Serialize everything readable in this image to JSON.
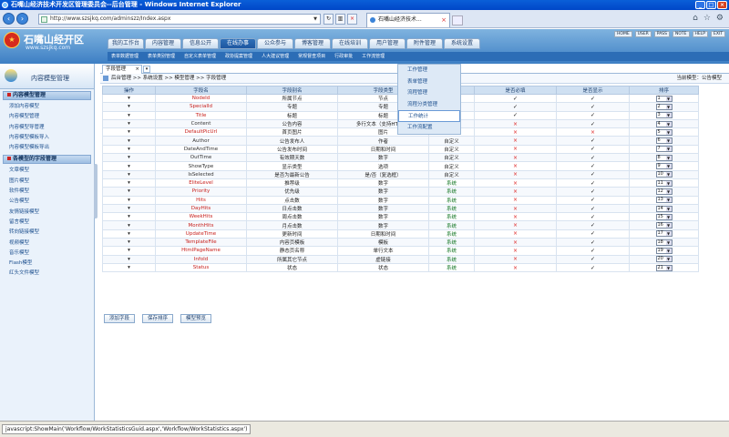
{
  "window": {
    "title": "石嘴山经济技术开发区管理委员会--后台管理 - Windows Internet Explorer"
  },
  "browser": {
    "url": "http://www.szsjkq.com/adminszz/Index.aspx",
    "tab_title": "石嘴山经济技术..."
  },
  "header": {
    "site_name": "石嘴山经开区",
    "site_url": "www.szsjkq.com",
    "top_links": [
      "HOME",
      "USER",
      "PASS",
      "NOTE",
      "HELP",
      "EXIT"
    ]
  },
  "main_nav": [
    "我的工作台",
    "内容管理",
    "信息公开",
    "在线办事",
    "公众参与",
    "博客管理",
    "在线培训",
    "用户管理",
    "附件管理",
    "系统设置"
  ],
  "main_nav_active": 3,
  "sub_nav": [
    "表单数据管理",
    "表单类别管理",
    "自定义表单管理",
    "政协提案管理",
    "人大建议管理",
    "常规督查项目",
    "行政审批",
    "工作流管理"
  ],
  "sidebar": {
    "title": "内容模型管理",
    "group1": {
      "title": "内容模型管理",
      "items": [
        "添加内容模型",
        "内容模型管理",
        "内容模型导管理",
        "内容模型模板导入",
        "内容模型模板导出"
      ]
    },
    "group2": {
      "title": "各模型的字段管理",
      "items": [
        "文章模型",
        "图片模型",
        "软件模型",
        "公告模型",
        "友情链接模型",
        "留言模型",
        "转向链接模型",
        "视频模型",
        "音乐模型",
        "Flash模型",
        "红头文件模型"
      ]
    }
  },
  "content": {
    "tab": "字段管理",
    "breadcrumb": "后台管理 >> 系统设置 >> 模型管理 >> 字段管理",
    "current_model": "当前模型：公告模型",
    "columns": [
      "操作",
      "字段名",
      "字段别名",
      "字段类型",
      "级别",
      "是否必填",
      "是否显示",
      "排序"
    ],
    "rows": [
      {
        "name": "NodeId",
        "alias": "所属节点",
        "type": "节点",
        "level": "系统",
        "req": true,
        "show": true,
        "order": "1",
        "red": true
      },
      {
        "name": "SpecialId",
        "alias": "专题",
        "type": "专题",
        "level": "系统",
        "req": true,
        "show": true,
        "order": "2",
        "red": true
      },
      {
        "name": "Title",
        "alias": "标题",
        "type": "标题",
        "level": "系统",
        "req": true,
        "show": true,
        "order": "3",
        "red": true
      },
      {
        "name": "Content",
        "alias": "公告内容",
        "type": "多行文本（支持HTML）",
        "level": "自定义",
        "req": false,
        "show": true,
        "order": "4",
        "red": false
      },
      {
        "name": "DefaultPicUrl",
        "alias": "首页图片",
        "type": "图片",
        "level": "系统",
        "req": false,
        "show": false,
        "order": "5",
        "red": true
      },
      {
        "name": "Author",
        "alias": "公告发布人",
        "type": "作者",
        "level": "自定义",
        "req": false,
        "show": true,
        "order": "6",
        "red": false
      },
      {
        "name": "DateAndTime",
        "alias": "公告发布时间",
        "type": "日期和时间",
        "level": "自定义",
        "req": false,
        "show": true,
        "order": "7",
        "red": false
      },
      {
        "name": "OutTime",
        "alias": "有效期天数",
        "type": "数字",
        "level": "自定义",
        "req": false,
        "show": true,
        "order": "8",
        "red": false
      },
      {
        "name": "ShowType",
        "alias": "显示类型",
        "type": "选项",
        "level": "自定义",
        "req": false,
        "show": true,
        "order": "9",
        "red": false
      },
      {
        "name": "IsSelected",
        "alias": "是否为最新公告",
        "type": "是/否（复选框）",
        "level": "自定义",
        "req": false,
        "show": true,
        "order": "10",
        "red": false
      },
      {
        "name": "EliteLevel",
        "alias": "推荐级",
        "type": "数字",
        "level": "系统",
        "req": false,
        "show": true,
        "order": "11",
        "red": true
      },
      {
        "name": "Priority",
        "alias": "优先级",
        "type": "数字",
        "level": "系统",
        "req": false,
        "show": true,
        "order": "12",
        "red": true
      },
      {
        "name": "Hits",
        "alias": "点击数",
        "type": "数字",
        "level": "系统",
        "req": false,
        "show": true,
        "order": "13",
        "red": true
      },
      {
        "name": "DayHits",
        "alias": "日点击数",
        "type": "数字",
        "level": "系统",
        "req": false,
        "show": true,
        "order": "14",
        "red": true
      },
      {
        "name": "WeekHits",
        "alias": "周点击数",
        "type": "数字",
        "level": "系统",
        "req": false,
        "show": true,
        "order": "15",
        "red": true
      },
      {
        "name": "MonthHits",
        "alias": "月点击数",
        "type": "数字",
        "level": "系统",
        "req": false,
        "show": true,
        "order": "16",
        "red": true
      },
      {
        "name": "UpdateTime",
        "alias": "更新时间",
        "type": "日期和时间",
        "level": "系统",
        "req": false,
        "show": true,
        "order": "17",
        "red": true
      },
      {
        "name": "TemplateFile",
        "alias": "内容页模板",
        "type": "模板",
        "level": "系统",
        "req": false,
        "show": true,
        "order": "18",
        "red": true
      },
      {
        "name": "HtmlPageName",
        "alias": "静态页名称",
        "type": "单行文本",
        "level": "系统",
        "req": false,
        "show": true,
        "order": "19",
        "red": true
      },
      {
        "name": "InfoId",
        "alias": "所属其它节点",
        "type": "虚链接",
        "level": "系统",
        "req": false,
        "show": true,
        "order": "20",
        "red": true
      },
      {
        "name": "Status",
        "alias": "状态",
        "type": "状态",
        "level": "系统",
        "req": false,
        "show": true,
        "order": "21",
        "red": true
      }
    ],
    "buttons": [
      "添加字段",
      "保存排序",
      "模型预览"
    ]
  },
  "workflow_menu": [
    "工作管理",
    "表单管理",
    "流程管理",
    "流程分类管理",
    "工作统计",
    "工作流配置"
  ],
  "workflow_menu_active": 4,
  "status_text": "javascript:ShowMain('Workflow/WorkStatisticsGuid.aspx','Workflow/WorkStatistics.aspx')"
}
